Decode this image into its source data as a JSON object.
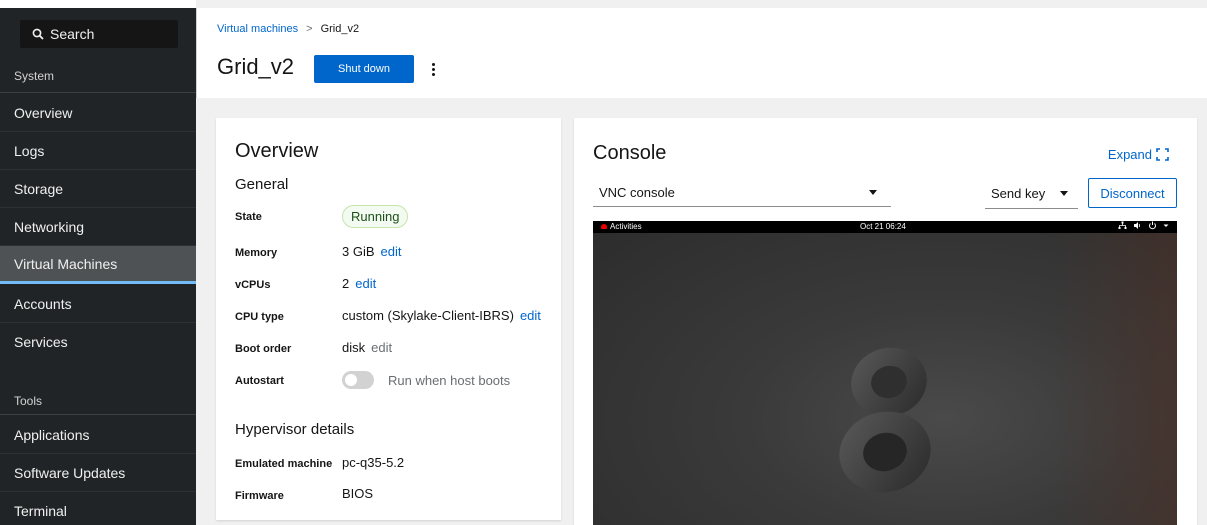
{
  "sidebar": {
    "search": "Search",
    "system_label": "System",
    "system_items": [
      "Overview",
      "Logs",
      "Storage",
      "Networking",
      "Virtual Machines",
      "Accounts",
      "Services"
    ],
    "tools_label": "Tools",
    "tools_items": [
      "Applications",
      "Software Updates",
      "Terminal"
    ],
    "active_item": "Virtual Machines"
  },
  "header": {
    "breadcrumb_link": "Virtual machines",
    "breadcrumb_separator": ">",
    "breadcrumb_current": "Grid_v2",
    "title": "Grid_v2",
    "shutdown_label": "Shut down"
  },
  "overview": {
    "title": "Overview",
    "general": "General",
    "state_label": "State",
    "state_value": "Running",
    "memory_label": "Memory",
    "memory_value": "3 GiB",
    "vcpus_label": "vCPUs",
    "vcpus_value": "2",
    "cputype_label": "CPU type",
    "cputype_value": "custom (Skylake-Client-IBRS)",
    "bootorder_label": "Boot order",
    "bootorder_value": "disk",
    "autostart_label": "Autostart",
    "autostart_value": "Run when host boots",
    "autostart_enabled": false,
    "edit_label": "edit",
    "hypervisor": "Hypervisor details",
    "emulated_label": "Emulated machine",
    "emulated_value": "pc-q35-5.2",
    "firmware_label": "Firmware",
    "firmware_value": "BIOS"
  },
  "console": {
    "title": "Console",
    "expand_label": "Expand",
    "type_value": "VNC console",
    "sendkey_label": "Send key",
    "disconnect_label": "Disconnect",
    "screen": {
      "activities": "Activities",
      "clock": "Oct 21 06:24",
      "logo_text": "8"
    }
  },
  "colors": {
    "accent": "#0066cc",
    "sidebar_bg": "#212427",
    "running_badge": "#f3faf2"
  }
}
